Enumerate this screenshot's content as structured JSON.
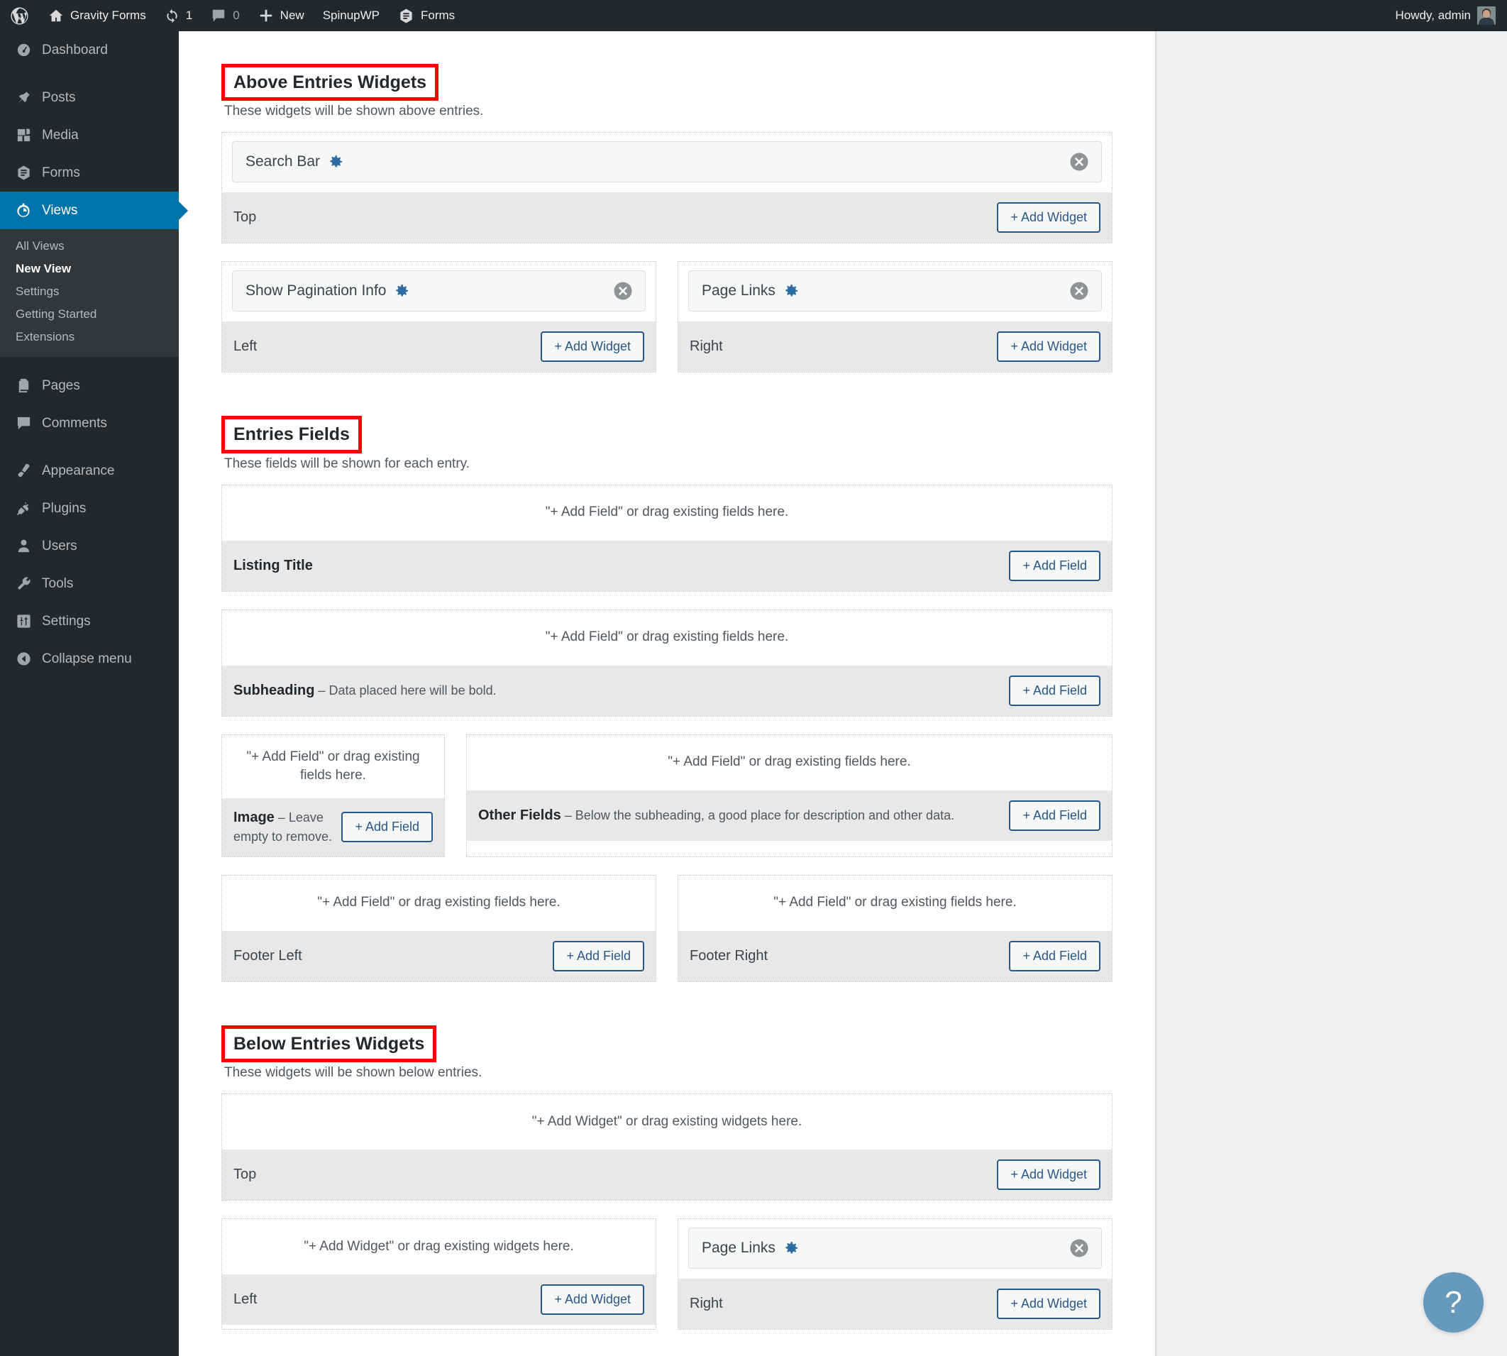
{
  "adminbar": {
    "items": [
      {
        "name": "wp-logo",
        "icon": "wordpress-logo",
        "label": ""
      },
      {
        "name": "site-name",
        "icon": "home-icon",
        "label": "Gravity Forms"
      },
      {
        "name": "updates",
        "icon": "update-icon",
        "label": "1"
      },
      {
        "name": "comments",
        "icon": "comment-bubble-icon",
        "label": "0"
      },
      {
        "name": "new-content",
        "icon": "plus-icon",
        "label": "New"
      },
      {
        "name": "spinupwp",
        "icon": "",
        "label": "SpinupWP"
      },
      {
        "name": "forms",
        "icon": "forms-icon",
        "label": "Forms"
      }
    ],
    "howdy": "Howdy, admin"
  },
  "sidebar": {
    "items": [
      {
        "label": "Dashboard",
        "icon": "dashboard-icon",
        "current": false
      },
      {
        "label": "Posts",
        "icon": "pin-icon",
        "current": false
      },
      {
        "label": "Media",
        "icon": "media-icon",
        "current": false
      },
      {
        "label": "Forms",
        "icon": "forms-icon",
        "current": false
      },
      {
        "label": "Views",
        "icon": "views-icon",
        "current": true
      },
      {
        "label": "Pages",
        "icon": "pages-icon",
        "current": false
      },
      {
        "label": "Comments",
        "icon": "comment-bubble-icon",
        "current": false
      },
      {
        "label": "Appearance",
        "icon": "paintbrush-icon",
        "current": false
      },
      {
        "label": "Plugins",
        "icon": "plug-icon",
        "current": false
      },
      {
        "label": "Users",
        "icon": "user-icon",
        "current": false
      },
      {
        "label": "Tools",
        "icon": "wrench-icon",
        "current": false
      },
      {
        "label": "Settings",
        "icon": "sliders-icon",
        "current": false
      },
      {
        "label": "Collapse menu",
        "icon": "collapse-arrow-icon",
        "current": false
      }
    ],
    "submenu": [
      {
        "label": "All Views",
        "current": false
      },
      {
        "label": "New View",
        "current": true
      },
      {
        "label": "Settings",
        "current": false
      },
      {
        "label": "Getting Started",
        "current": false
      },
      {
        "label": "Extensions",
        "current": false
      }
    ]
  },
  "sections": {
    "above": {
      "title": "Above Entries Widgets",
      "subtitle": "These widgets will be shown above entries.",
      "zones": [
        {
          "area_label": "Top",
          "button": "+ Add Widget",
          "placeholder": "",
          "widgets": [
            {
              "title": "Search Bar",
              "gear": "gear-icon",
              "close": "close-icon"
            }
          ]
        },
        {
          "area_label": "Left",
          "button": "+ Add Widget",
          "placeholder": "",
          "widgets": [
            {
              "title": "Show Pagination Info",
              "gear": "gear-icon",
              "close": "close-icon"
            }
          ]
        },
        {
          "area_label": "Right",
          "button": "+ Add Widget",
          "placeholder": "",
          "widgets": [
            {
              "title": "Page Links",
              "gear": "gear-icon",
              "close": "close-icon"
            }
          ]
        }
      ]
    },
    "fields": {
      "title": "Entries Fields",
      "subtitle": "These fields will be shown for each entry.",
      "placeholder": "\"+ Add Field\" or drag existing fields here.",
      "button": "+ Add Field",
      "zones": [
        {
          "label": "Listing Title",
          "note": ""
        },
        {
          "label": "Subheading",
          "note": " – Data placed here will be bold."
        },
        {
          "label": "Image",
          "note": " – Leave empty to remove."
        },
        {
          "label": "Other Fields",
          "note": " – Below the subheading, a good place for description and other data."
        },
        {
          "label": "Footer Left",
          "note": ""
        },
        {
          "label": "Footer Right",
          "note": ""
        }
      ]
    },
    "below": {
      "title": "Below Entries Widgets",
      "subtitle": "These widgets will be shown below entries.",
      "placeholder": "\"+ Add Widget\" or drag existing widgets here.",
      "button": "+ Add Widget",
      "zones": [
        {
          "area_label": "Top",
          "widgets": []
        },
        {
          "area_label": "Left",
          "widgets": []
        },
        {
          "area_label": "Right",
          "widgets": [
            {
              "title": "Page Links",
              "gear": "gear-icon",
              "close": "close-icon"
            }
          ]
        }
      ]
    }
  },
  "help": {
    "label": "?"
  },
  "colors": {
    "admin_bar": "#23282d",
    "sidebar": "#23282d",
    "sidebar_current": "#0073aa",
    "annotation_box": "#ff0000",
    "button_border": "#2b5787",
    "help_bubble": "#6699bb",
    "gear": "#2e6da4"
  }
}
